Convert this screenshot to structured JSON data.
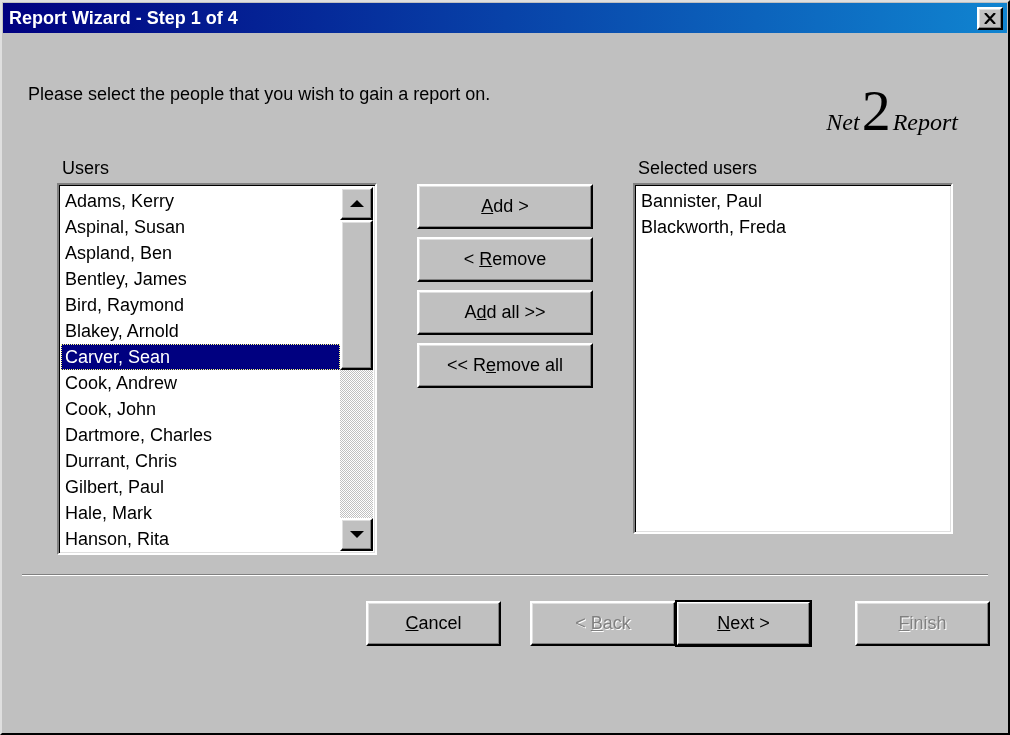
{
  "window": {
    "title": "Report Wizard - Step 1 of 4"
  },
  "instruction": "Please select the people that you wish to gain a report on.",
  "logo": {
    "prefix": "Net",
    "numeral": "2",
    "suffix": "Report"
  },
  "users": {
    "label": "Users",
    "items": [
      {
        "name": "Adams, Kerry",
        "selected": false
      },
      {
        "name": "Aspinal, Susan",
        "selected": false
      },
      {
        "name": "Aspland, Ben",
        "selected": false
      },
      {
        "name": "Bentley, James",
        "selected": false
      },
      {
        "name": "Bird, Raymond",
        "selected": false
      },
      {
        "name": "Blakey, Arnold",
        "selected": false
      },
      {
        "name": "Carver, Sean",
        "selected": true
      },
      {
        "name": "Cook, Andrew",
        "selected": false
      },
      {
        "name": "Cook, John",
        "selected": false
      },
      {
        "name": "Dartmore, Charles",
        "selected": false
      },
      {
        "name": "Durrant, Chris",
        "selected": false
      },
      {
        "name": "Gilbert, Paul",
        "selected": false
      },
      {
        "name": "Hale, Mark",
        "selected": false
      },
      {
        "name": "Hanson, Rita",
        "selected": false
      }
    ]
  },
  "transfer_buttons": [
    {
      "key": "A",
      "after": "dd >"
    },
    {
      "before": "< ",
      "key": "R",
      "after": "emove"
    },
    {
      "before": "A",
      "key": "d",
      "after": "d all >>"
    },
    {
      "before": "<< R",
      "key": "e",
      "after": "move all"
    }
  ],
  "selected_users": {
    "label": "Selected users",
    "items": [
      {
        "name": "Bannister, Paul",
        "selected": false
      },
      {
        "name": "Blackworth, Freda",
        "selected": false
      }
    ]
  },
  "wizard_buttons": [
    {
      "key": "C",
      "after": "ancel",
      "disabled": false,
      "default": false
    },
    {
      "before": "< ",
      "key": "B",
      "after": "ack",
      "disabled": true,
      "default": false
    },
    {
      "key": "N",
      "after": "ext >",
      "disabled": false,
      "default": true
    },
    {
      "key": "F",
      "after": "inish",
      "disabled": true,
      "default": false
    }
  ]
}
